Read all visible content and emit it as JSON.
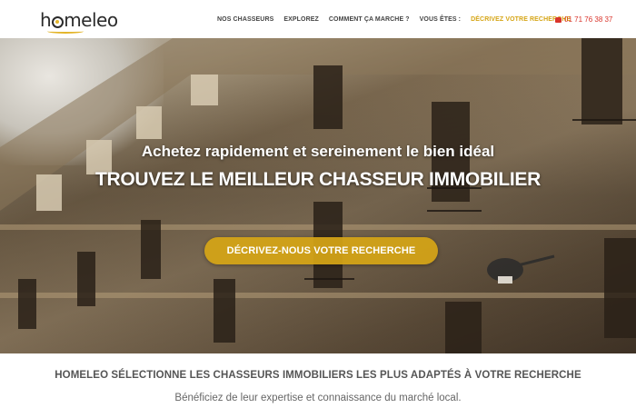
{
  "brand": {
    "logo_text_left": "h",
    "logo_text_right": "meleo",
    "accent": "#d6a516"
  },
  "nav": {
    "items": [
      {
        "label": "NOS CHASSEURS",
        "active": false
      },
      {
        "label": "EXPLOREZ",
        "active": false
      },
      {
        "label": "COMMENT ÇA MARCHE ?",
        "active": false
      },
      {
        "label": "VOUS ÊTES :",
        "active": false
      },
      {
        "label": "DÉCRIVEZ VOTRE RECHERCHE",
        "active": true
      }
    ],
    "phone": "01 71 76 38 37",
    "phone_icon": "phone-icon"
  },
  "hero": {
    "subtitle": "Achetez rapidement et sereinement le bien idéal",
    "title": "TROUVEZ LE MEILLEUR CHASSEUR IMMOBILIER",
    "cta_label": "DÉCRIVEZ-NOUS VOTRE RECHERCHE"
  },
  "section": {
    "title": "HOMELEO SÉLECTIONNE LES CHASSEURS IMMOBILIERS LES PLUS ADAPTÉS À VOTRE RECHERCHE",
    "subtitle": "Bénéficiez de leur expertise et connaissance du marché local."
  }
}
